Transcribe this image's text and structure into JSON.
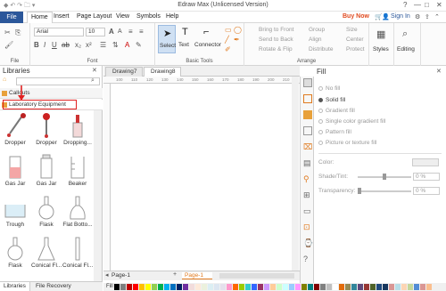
{
  "window": {
    "title": "Edraw Max (Unlicensed Version)"
  },
  "menu": {
    "tabs": [
      "File",
      "Home",
      "Insert",
      "Page Layout",
      "View",
      "Symbols",
      "Help"
    ],
    "buy_now": "Buy Now",
    "sign_in": "Sign In"
  },
  "ribbon": {
    "file_group": "File",
    "font_group": "Font",
    "font_name": "Arial",
    "font_size": "10",
    "basic_tools": "Basic Tools",
    "select": "Select",
    "text": "Text",
    "connector": "Connector",
    "arrange": "Arrange",
    "bring_to_front": "Bring to Front",
    "send_to_back": "Send to Back",
    "rotate_flip": "Rotate & Flip",
    "group": "Group",
    "align": "Align",
    "distribute": "Distribute",
    "size": "Size",
    "center": "Center",
    "protect": "Protect",
    "styles": "Styles",
    "editing": "Editing"
  },
  "libraries": {
    "title": "Libraries",
    "categories": [
      "Callouts",
      "Laboratory Equipment"
    ],
    "shapes": [
      "Dropper",
      "Dropper",
      "Dropping...",
      "Gas Jar",
      "Gas Jar",
      "Beaker",
      "Trough",
      "Flask",
      "Flat Botto...",
      "Flask",
      "Conical Fl...",
      "Conical Fl..."
    ],
    "bottom_tabs": [
      "Libraries",
      "File Recovery"
    ]
  },
  "documents": {
    "tabs": [
      "Drawing7",
      "Drawing8"
    ],
    "page_tabs": [
      "Page-1",
      "Page-1"
    ],
    "fill_label": "Fill",
    "ruler_marks": [
      "100",
      "110",
      "120",
      "130",
      "140",
      "150",
      "160",
      "170",
      "180",
      "190",
      "200",
      "210"
    ]
  },
  "fill_panel": {
    "title": "Fill",
    "options": [
      "No fill",
      "Solid fill",
      "Gradient fill",
      "Single color gradient fill",
      "Pattern fill",
      "Picture or texture fill"
    ],
    "selected": "Solid fill",
    "color_label": "Color:",
    "shade_label": "Shade/Tint:",
    "shade_value": "0 %",
    "transparency_label": "Transparency:",
    "transparency_value": "0 %"
  },
  "colors": {
    "file_tab": "#2b579a",
    "buy_now": "#e04a1f",
    "annotation": "#e02020",
    "swatches": [
      "#000000",
      "#7f7f7f",
      "#c00000",
      "#ff0000",
      "#ffc000",
      "#ffff00",
      "#92d050",
      "#00b050",
      "#00b0f0",
      "#0070c0",
      "#002060",
      "#7030a0",
      "#f2dcdb",
      "#fde9d9",
      "#ebf1dd",
      "#dbeef3",
      "#dce6f1",
      "#e5e0ec",
      "#ff99cc",
      "#ff6600",
      "#99cc00",
      "#33cccc",
      "#3366ff",
      "#993366",
      "#cc99ff",
      "#ffcc99",
      "#ccffcc",
      "#ccffff",
      "#99ccff",
      "#ff99ff",
      "#808000",
      "#008080",
      "#800000",
      "#808080",
      "#c0c0c0",
      "#ffffff",
      "#e26b0a",
      "#948a54",
      "#31869b",
      "#60497a",
      "#963634",
      "#4f6228",
      "#1f497d",
      "#17375e",
      "#d99694",
      "#b7dee8",
      "#fcd5b4",
      "#c4d79b",
      "#538dd5",
      "#da9694",
      "#fabf8f"
    ]
  }
}
